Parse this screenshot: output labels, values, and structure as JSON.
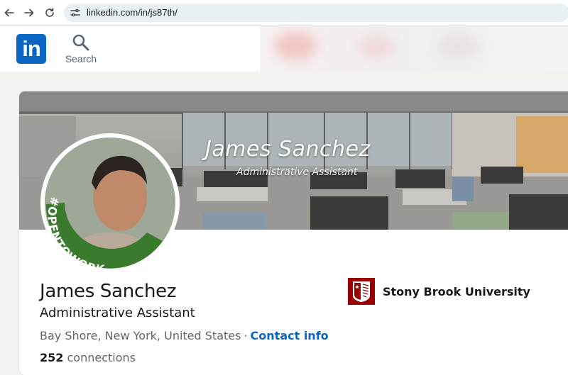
{
  "browser": {
    "url": "linkedin.com/in/js87th/"
  },
  "header": {
    "logo_text": "in",
    "search_label": "Search"
  },
  "banner": {
    "title": "James Sanchez",
    "subtitle": "Administrative Assistant"
  },
  "avatar": {
    "badge_text": "#OPENTOWORK",
    "badge_color": "#3a7a2c"
  },
  "profile": {
    "name": "James Sanchez",
    "headline": "Administrative Assistant",
    "location": "Bay Shore, New York, United States",
    "separator": "·",
    "contact_link": "Contact info",
    "connections_count": "252",
    "connections_label": "connections"
  },
  "education": {
    "school": "Stony Brook University",
    "logo_color": "#990000"
  },
  "colors": {
    "brand": "#0a66c2",
    "page_bg": "#f4f2ee"
  }
}
